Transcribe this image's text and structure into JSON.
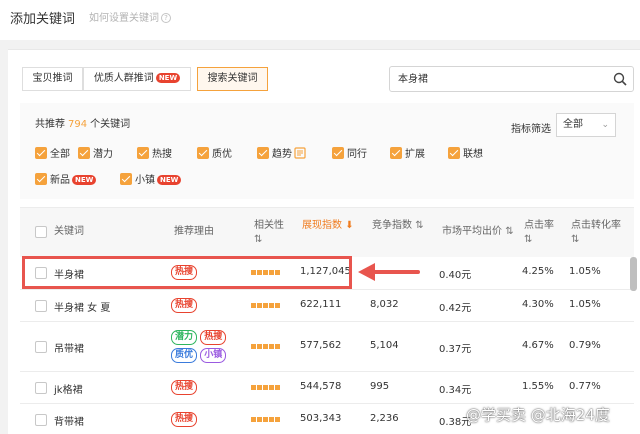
{
  "header": {
    "title": "添加关键词",
    "help_link": "如何设置关键词",
    "help_icon": "question-circle-icon"
  },
  "tabs": [
    {
      "label": "宝贝推词",
      "badge": ""
    },
    {
      "label": "优质人群推词",
      "badge": "NEW"
    },
    {
      "label": "搜索关键词",
      "badge": ""
    }
  ],
  "search": {
    "value": "本身裙",
    "icon": "search-icon"
  },
  "summary": {
    "prefix": "共推荐",
    "count": "794",
    "suffix": "个关键词"
  },
  "metric_filter": {
    "label": "指标筛选",
    "selected": "全部"
  },
  "filters": [
    {
      "label": "全部",
      "checked": true,
      "badge": ""
    },
    {
      "label": "潜力",
      "checked": true,
      "badge": ""
    },
    {
      "label": "热搜",
      "checked": true,
      "badge": ""
    },
    {
      "label": "质优",
      "checked": true,
      "badge": ""
    },
    {
      "label": "趋势",
      "checked": true,
      "badge": "",
      "icon": "chart-note-icon"
    },
    {
      "label": "同行",
      "checked": true,
      "badge": ""
    },
    {
      "label": "扩展",
      "checked": true,
      "badge": ""
    },
    {
      "label": "联想",
      "checked": true,
      "badge": ""
    },
    {
      "label": "新品",
      "checked": true,
      "badge": "NEW"
    },
    {
      "label": "小镇",
      "checked": true,
      "badge": "NEW"
    }
  ],
  "table": {
    "headers": {
      "keyword": "关键词",
      "reason": "推荐理由",
      "relevance": "相关性",
      "display_index": "展现指数",
      "competition_index": "竞争指数",
      "avg_bid": "市场平均出价",
      "ctr": "点击率",
      "cvr": "点击转化率"
    },
    "rows": [
      {
        "keyword": "半身裙",
        "tags": [
          "热搜"
        ],
        "relevance": 5,
        "display": "1,127,045",
        "competition": "",
        "bid": "0.40元",
        "ctr": "4.25%",
        "cvr": "1.05%"
      },
      {
        "keyword": "半身裙 女 夏",
        "tags": [
          "热搜"
        ],
        "relevance": 5,
        "display": "622,111",
        "competition": "8,032",
        "bid": "0.42元",
        "ctr": "4.30%",
        "cvr": "1.05%"
      },
      {
        "keyword": "吊带裙",
        "tags": [
          "潜力",
          "热搜",
          "质优",
          "小镇"
        ],
        "relevance": 5,
        "display": "577,562",
        "competition": "5,104",
        "bid": "0.37元",
        "ctr": "4.67%",
        "cvr": "0.79%"
      },
      {
        "keyword": "jk格裙",
        "tags": [
          "热搜"
        ],
        "relevance": 5,
        "display": "544,578",
        "competition": "995",
        "bid": "0.34元",
        "ctr": "1.55%",
        "cvr": "0.77%"
      },
      {
        "keyword": "背带裙",
        "tags": [
          "热搜"
        ],
        "relevance": 5,
        "display": "503,343",
        "competition": "2,236",
        "bid": "0.38元",
        "ctr": "",
        "cvr": ""
      }
    ]
  },
  "watermark": "@学买卖 @北海24度",
  "colors": {
    "accent": "#f5a23c",
    "hot": "#e8432f",
    "highlight": "#e8554e"
  }
}
